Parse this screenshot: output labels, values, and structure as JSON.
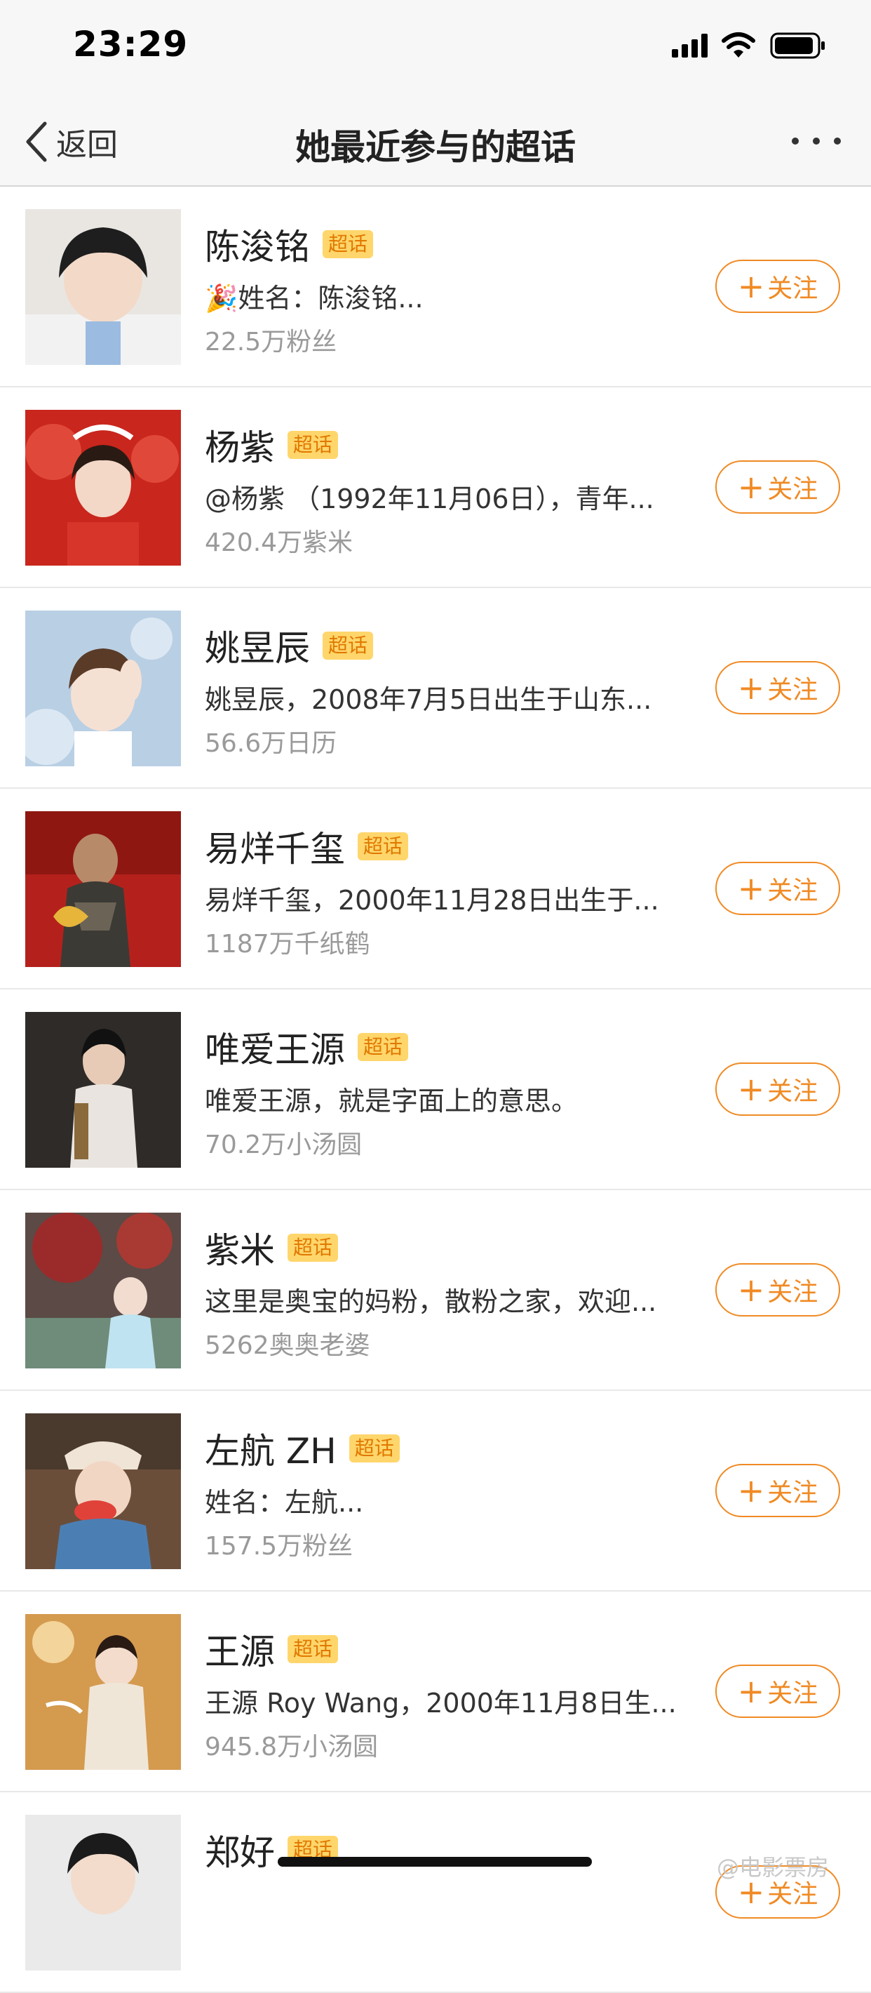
{
  "status_bar": {
    "time": "23:29"
  },
  "nav": {
    "back_label": "返回",
    "title": "她最近参与的超话"
  },
  "items": [
    {
      "name": "陈浚铭",
      "badge": "超话",
      "desc": "🎉姓名：陈浚铭...",
      "stat": "22.5万粉丝",
      "follow": "关注"
    },
    {
      "name": "杨紫",
      "badge": "超话",
      "desc": "@杨紫 （1992年11月06日），青年...",
      "stat": "420.4万紫米",
      "follow": "关注"
    },
    {
      "name": "姚昱辰",
      "badge": "超话",
      "desc": "姚昱辰，2008年7月5日出生于山东...",
      "stat": "56.6万日历",
      "follow": "关注"
    },
    {
      "name": "易烊千玺",
      "badge": "超话",
      "desc": "易烊千玺，2000年11月28日出生于...",
      "stat": "1187万千纸鹤",
      "follow": "关注"
    },
    {
      "name": "唯爱王源",
      "badge": "超话",
      "desc": "唯爱王源，就是字面上的意思。",
      "stat": "70.2万小汤圆",
      "follow": "关注"
    },
    {
      "name": "紫米",
      "badge": "超话",
      "desc": "这里是奥宝的妈粉，散粉之家，欢迎...",
      "stat": "5262奥奥老婆",
      "follow": "关注"
    },
    {
      "name": "左航 ZH",
      "badge": "超话",
      "desc": "姓名：左航...",
      "stat": "157.5万粉丝",
      "follow": "关注"
    },
    {
      "name": "王源",
      "badge": "超话",
      "desc": "王源 Roy Wang，2000年11月8日生...",
      "stat": "945.8万小汤圆",
      "follow": "关注"
    },
    {
      "name": "郑好",
      "badge": "超话",
      "desc": "",
      "stat": "",
      "follow": "关注"
    }
  ],
  "watermark": "@电影票房",
  "colors": {
    "accent": "#f08a24",
    "badge_bg": "#ffd66b",
    "badge_text": "#e07800",
    "muted_text": "#9a9a9a"
  }
}
